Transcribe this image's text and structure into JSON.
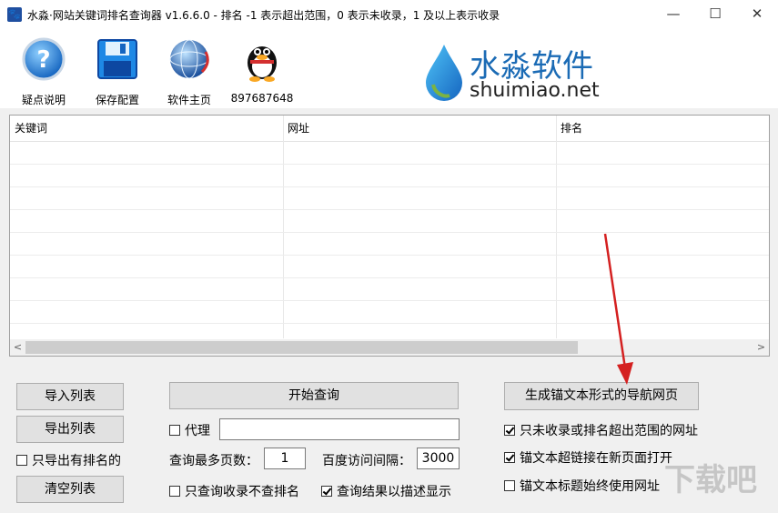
{
  "window": {
    "title": "水淼·网站关键词排名查询器 v1.6.6.0 - 排名 -1 表示超出范围，0 表示未收录，1 及以上表示收录"
  },
  "toolbar": {
    "help_label": "疑点说明",
    "save_label": "保存配置",
    "home_label": "软件主页",
    "qq_label": "897687648"
  },
  "logo": {
    "cn": "水淼软件",
    "en": "shuimiao.net"
  },
  "table": {
    "columns": [
      "关键词",
      "网址",
      "排名"
    ]
  },
  "buttons": {
    "import": "导入列表",
    "export": "导出列表",
    "clear": "清空列表",
    "start": "开始查询",
    "generate": "生成锚文本形式的导航网页"
  },
  "options": {
    "export_ranked_only": "只导出有排名的",
    "proxy": "代理",
    "proxy_value": "",
    "max_pages_label": "查询最多页数：",
    "max_pages_value": "1",
    "interval_label": "百度访问间隔：",
    "interval_value": "3000",
    "only_index": "只查询收录不查排名",
    "show_desc": "查询结果以描述显示",
    "only_unindexed": "只未收录或排名超出范围的网址",
    "open_new_page": "锚文本超链接在新页面打开",
    "title_use_url": "锚文本标题始终使用网址"
  },
  "checks": {
    "export_ranked_only": false,
    "proxy": false,
    "only_index": false,
    "show_desc": true,
    "only_unindexed": true,
    "open_new_page": true,
    "title_use_url": false
  },
  "watermark": "下载吧",
  "colors": {
    "logo_blue": "#1b6bb5",
    "arrow_red": "#d42020"
  }
}
